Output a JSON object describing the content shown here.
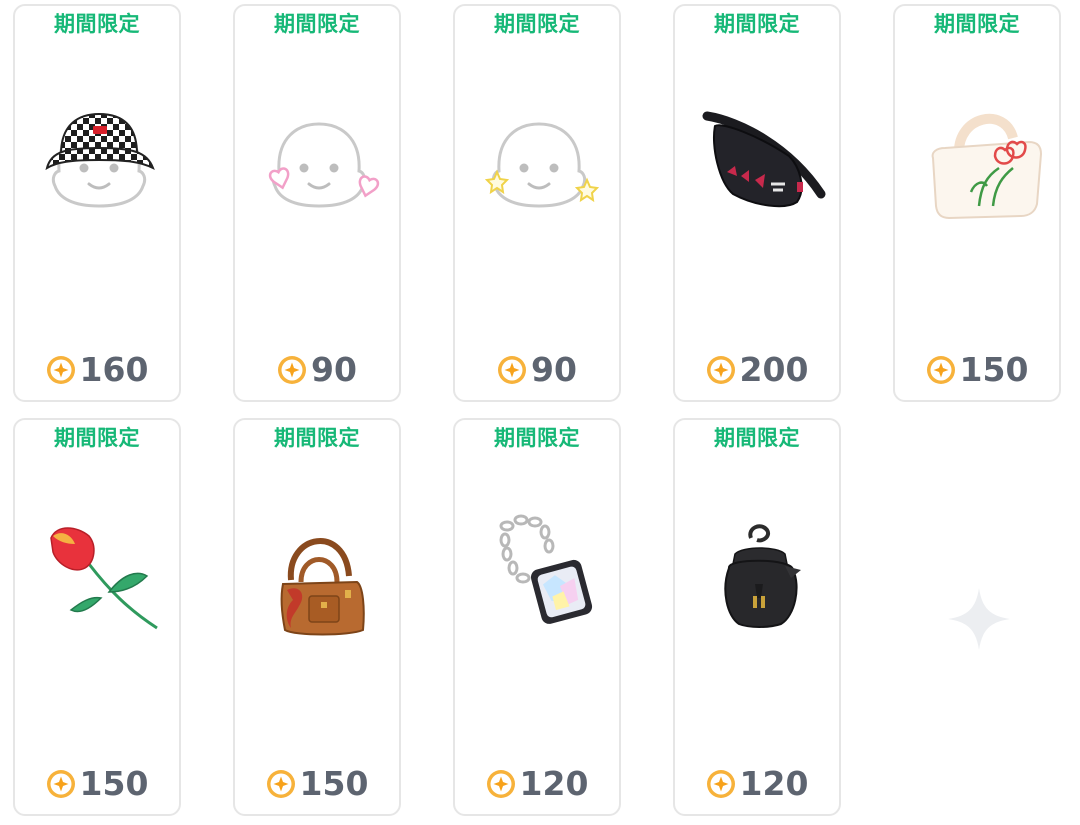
{
  "items": [
    {
      "badge": "期間限定",
      "price": "160",
      "icon": "checkered-bucket-hat-icon"
    },
    {
      "badge": "期間限定",
      "price": "90",
      "icon": "heart-earrings-icon"
    },
    {
      "badge": "期間限定",
      "price": "90",
      "icon": "star-earrings-icon"
    },
    {
      "badge": "期間限定",
      "price": "200",
      "icon": "black-waist-bag-icon"
    },
    {
      "badge": "期間限定",
      "price": "150",
      "icon": "tulip-tote-bag-icon"
    },
    {
      "badge": "期間限定",
      "price": "150",
      "icon": "red-tulip-icon"
    },
    {
      "badge": "期間限定",
      "price": "150",
      "icon": "brown-handbag-icon"
    },
    {
      "badge": "期間限定",
      "price": "120",
      "icon": "chain-phone-pouch-icon"
    },
    {
      "badge": "期間限定",
      "price": "120",
      "icon": "black-drawstring-pouch-icon"
    }
  ],
  "placeholder": {
    "icon": "sparkle-placeholder-icon"
  },
  "colors": {
    "badge": "#16b877",
    "price": "#5d6470",
    "coin": "#f5a623",
    "card_border": "#e6e6e6"
  }
}
